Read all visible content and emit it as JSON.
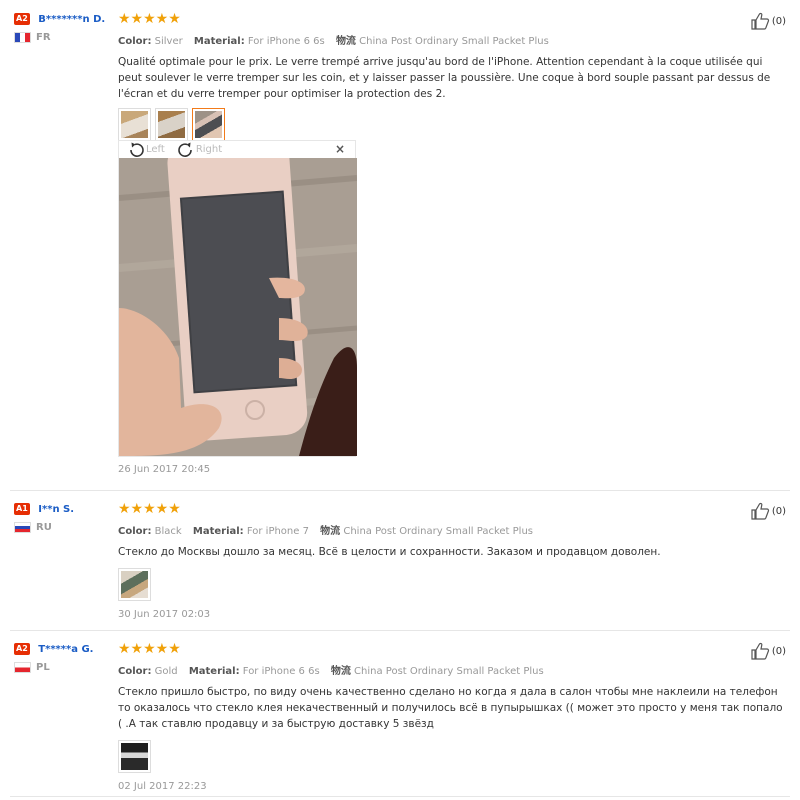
{
  "reviews": [
    {
      "badge": "A2",
      "username": "B*******n D.",
      "country": "FR",
      "stars": "★★★★★",
      "color_label": "Color:",
      "color_value": "Silver",
      "material_label": "Material:",
      "material_value": "For iPhone 6 6s",
      "shipping_label": "物流",
      "shipping_value": "China Post Ordinary Small Packet Plus",
      "text": "Qualité optimale pour le prix. Le verre trempé arrive jusqu'au bord de l'iPhone. Attention cependant à la coque utilisée qui peut soulever le verre tremper sur les coin, et y laisser passer la poussière. Une coque à bord souple passant par dessus de l'écran et du verre tremper pour optimiser la protection des 2.",
      "date": "26 Jun 2017 20:45",
      "likes": "(0)"
    },
    {
      "badge": "A1",
      "username": "I**n S.",
      "country": "RU",
      "stars": "★★★★★",
      "color_label": "Color:",
      "color_value": "Black",
      "material_label": "Material:",
      "material_value": "For iPhone 7",
      "shipping_label": "物流",
      "shipping_value": "China Post Ordinary Small Packet Plus",
      "text": "Стекло до Москвы дошло за месяц. Всё в целости и сохранности. Заказом и продавцом доволен.",
      "date": "30 Jun 2017 02:03",
      "likes": "(0)"
    },
    {
      "badge": "A2",
      "username": "T*****a G.",
      "country": "PL",
      "stars": "★★★★★",
      "color_label": "Color:",
      "color_value": "Gold",
      "material_label": "Material:",
      "material_value": "For iPhone 6 6s",
      "shipping_label": "物流",
      "shipping_value": "China Post Ordinary Small Packet Plus",
      "text": "Стекло пришло быстро, по виду очень качественно сделано но когда я дала в салон чтобы мне наклеили на телефон то оказалось что стекло клея некачественный и получилось всё в пупырышках (( может это просто у меня так попало ( .А так ставлю продавцу и за быструю доставку 5 звёзд",
      "date": "02 Jul 2017 22:23",
      "likes": "(0)"
    }
  ],
  "viewer": {
    "rotate_left": "Left",
    "rotate_right": "Right",
    "close": "×"
  },
  "colors": {
    "accent_orange": "#f27b1a",
    "star": "#f0a10a",
    "username": "#1a5cc5",
    "badge": "#e62e04"
  }
}
